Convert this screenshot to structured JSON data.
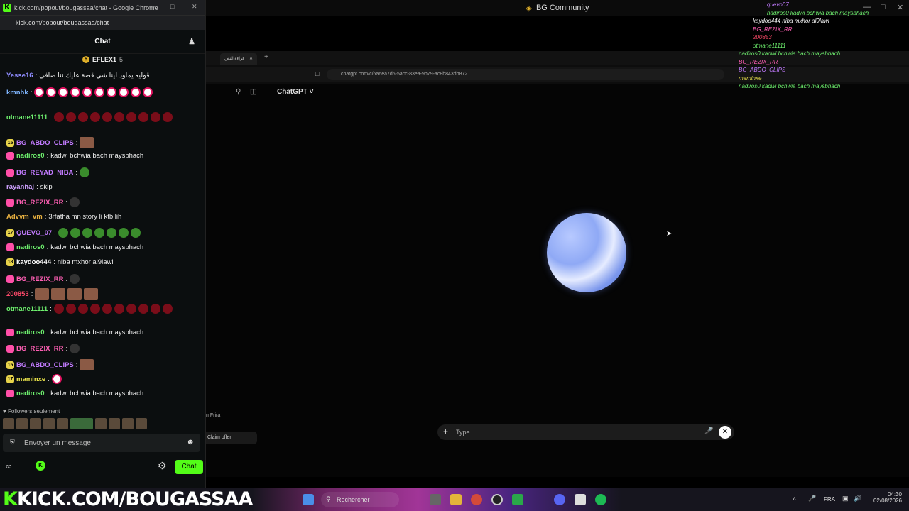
{
  "chat_window": {
    "chrome_title": "kick.com/popout/bougassaa/chat - Google Chrome",
    "url": "kick.com/popout/bougassaa/chat",
    "header": "Chat",
    "pinned_user": "EFLEX1",
    "pinned_count": "5",
    "messages": [
      {
        "user": "Yesse16",
        "text": "قوليه يماود لينا شي قصة عليك ننا صافي",
        "color": "#8f8cff"
      },
      {
        "user": "kmnhk",
        "text": "",
        "color": "#7fb6ff"
      },
      {
        "user": "otmane11111",
        "text": "",
        "color": "#6ef06e"
      },
      {
        "user": "BG_ABDO_CLIPS",
        "text": "",
        "color": "#c27bff",
        "badge": "15"
      },
      {
        "user": "nadiros0",
        "text": "kadwi bchwia bach maysbhach",
        "color": "#6ef06e"
      },
      {
        "user": "BG_REYAD_NIBA",
        "text": "",
        "color": "#c27bff"
      },
      {
        "user": "rayanhaj",
        "text": "skip",
        "color": "#cfa2ff"
      },
      {
        "user": "BG_REZIX_RR",
        "text": "",
        "color": "#ff5fb4"
      },
      {
        "user": "Advvm_vm",
        "text": "3rfatha mn story li ktb lih",
        "color": "#e7b040"
      },
      {
        "user": "QUEVO_07",
        "text": "",
        "color": "#c27bff",
        "badge": "17"
      },
      {
        "user": "nadiros0",
        "text": "kadwi bchwia bach maysbhach",
        "color": "#6ef06e"
      },
      {
        "user": "kaydoo444",
        "text": "niba mxhor al9lawi",
        "color": "#ffffff",
        "badge": "18"
      },
      {
        "user": "BG_REZIX_RR",
        "text": "",
        "color": "#ff5fb4"
      },
      {
        "user": "200853",
        "text": "",
        "color": "#ff4a6a"
      },
      {
        "user": "otmane11111",
        "text": "",
        "color": "#6ef06e"
      },
      {
        "user": "nadiros0",
        "text": "kadwi bchwia bach maysbhach",
        "color": "#6ef06e"
      },
      {
        "user": "BG_REZIX_RR",
        "text": "",
        "color": "#ff5fb4"
      },
      {
        "user": "BG_ABDO_CLIPS",
        "text": "",
        "color": "#c27bff",
        "badge": "15"
      },
      {
        "user": "maminxe",
        "text": "",
        "color": "#e7e04a",
        "badge": "17"
      },
      {
        "user": "nadiros0",
        "text": "kadwi bchwia bach maysbhach",
        "color": "#6ef06e"
      }
    ],
    "followers_label": "Followers seulement",
    "input_placeholder": "Envoyer un message",
    "chat_button": "Chat"
  },
  "stream": {
    "window_title": "BG Community",
    "inner_tab": "قراءة النص",
    "inner_url": "chatgpt.com/c/6a6ea7d6-5acc-83ea-9b79-ac8b843db872",
    "app_title": "ChatGPT",
    "composer_placeholder": "Type",
    "claim_offer": "Claim offer",
    "side_text": "n Frira"
  },
  "overlay": {
    "lines": [
      {
        "text": "quevo07 ...",
        "color": "#c27bff"
      },
      {
        "text": "nadiros0 kadwi bchwia bach maysbhach",
        "color": "#6ef06e"
      },
      {
        "text": "kaydoo444 niba mxhor al9lawi",
        "color": "#ffffff"
      },
      {
        "text": "BG_REZIX_RR",
        "color": "#ff5fb4"
      },
      {
        "text": "200853",
        "color": "#ff4a6a"
      },
      {
        "text": "otmane11111",
        "color": "#6ef06e"
      },
      {
        "text": "nadiros0 kadwi bchwia bach maysbhach",
        "color": "#6ef06e"
      },
      {
        "text": "BG_REZIX_RR",
        "color": "#ff5fb4"
      },
      {
        "text": "BG_ABDO_CLIPS",
        "color": "#c27bff"
      },
      {
        "text": "maminxe",
        "color": "#e7e04a"
      },
      {
        "text": "nadiros0 kadwi bchwia bach maysbhach",
        "color": "#6ef06e"
      }
    ]
  },
  "taskbar": {
    "banner_k": "K",
    "banner_text": "KICK.COM/BOUGASSAA",
    "search_label": "Rechercher",
    "lang": "FRA",
    "time": "04:30",
    "date": "02/08/2026"
  },
  "colors": {
    "kick_green": "#53fc18",
    "accent_pink": "#ff4fa8"
  }
}
